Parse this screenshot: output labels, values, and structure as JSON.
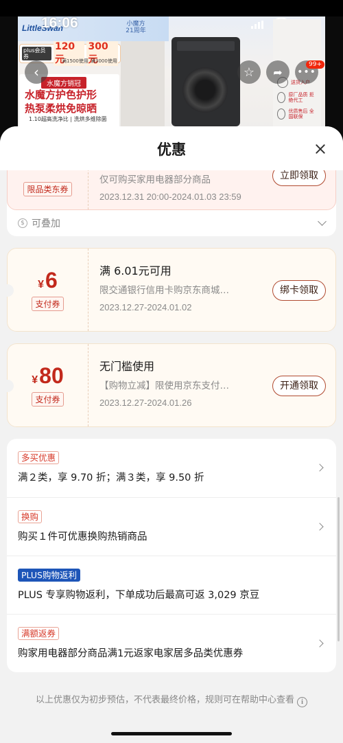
{
  "status_bar": {
    "time": "16:06"
  },
  "background_page": {
    "brand_logo": "LittleSwan",
    "brand_sub": "小魔方 21周年",
    "promo_label": "plus会员券",
    "promo_amount_1": "120元",
    "promo_amount_2": "300元",
    "promo_sub_1": "满1500使用",
    "promo_sub_2": "满3000使用",
    "banner_tag": "水魔方销冠",
    "banner_headline_1": "水魔方护色护形",
    "banner_headline_2": "热泵柔烘免晾晒",
    "banner_small": "1.10超高洗净比 | 洗烘多维除菌",
    "features": [
      "送货入户",
      "原厂品质 拒绝代工",
      "优质售后 全国联保"
    ],
    "cart_badge": "99+"
  },
  "sheet": {
    "title": "优惠",
    "coupons": [
      {
        "desc": "仅可购买家用电器部分商品",
        "date": "2023.12.31 20:00-2024.01.03 23:59",
        "tag": "限品类东券",
        "button": "立即领取",
        "stack_label": "可叠加"
      },
      {
        "currency": "¥",
        "amount": "6",
        "tag": "支付券",
        "title": "满 6.01元可用",
        "desc": "限交通银行信用卡购京东商城…",
        "date": "2023.12.27-2024.01.02",
        "button": "绑卡领取"
      },
      {
        "currency": "¥",
        "amount": "80",
        "tag": "支付券",
        "title": "无门槛使用",
        "desc": "【购物立减】限使用京东支付…",
        "date": "2023.12.27-2024.01.26",
        "button": "开通领取"
      }
    ],
    "promotions": [
      {
        "tag": "多买优惠",
        "text": "满２类，享 9.70 折；满３类，享 9.50 折"
      },
      {
        "tag": "换购",
        "text": "购买１件可优惠换购热销商品"
      },
      {
        "tag": "PLUS购物返利",
        "text": "PLUS 专享购物返利，下单成功后最高可返 3,029 京豆"
      },
      {
        "tag": "满额返券",
        "text": "购家用电器部分商品满1元返家电家居多品类优惠券"
      }
    ],
    "footer_note": "以上优惠仅为初步预估，不代表最终价格，规则可在帮助中心查看"
  },
  "colors": {
    "accent_red": "#c2291c",
    "plus_blue": "#1d55b8"
  }
}
